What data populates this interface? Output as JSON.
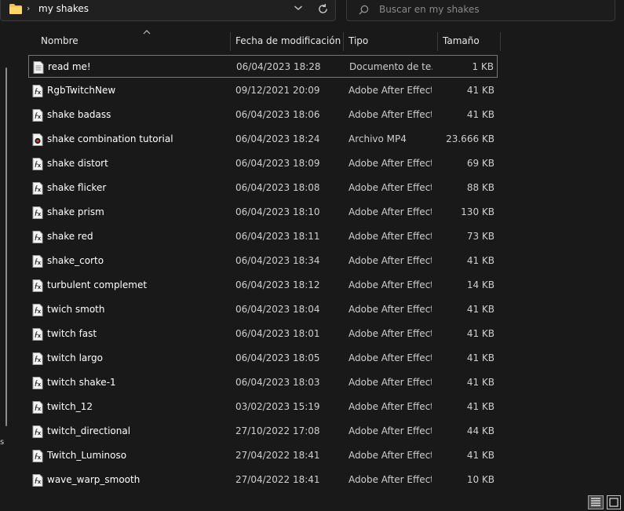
{
  "address": {
    "breadcrumb_sep": "›",
    "folder": "my shakes"
  },
  "search": {
    "placeholder": "Buscar en my shakes"
  },
  "columns": {
    "name": "Nombre",
    "date": "Fecha de modificación",
    "type": "Tipo",
    "size": "Tamaño"
  },
  "left_mark": "s",
  "files": [
    {
      "name": "read me!",
      "date": "06/04/2023 18:28",
      "type": "Documento de te...",
      "size": "1 KB",
      "icon": "text-document-icon"
    },
    {
      "name": "RgbTwitchNew",
      "date": "09/12/2021 20:09",
      "type": "Adobe After Effect...",
      "size": "41 KB",
      "icon": "after-effects-preset-icon"
    },
    {
      "name": "shake badass",
      "date": "06/04/2023 18:06",
      "type": "Adobe After Effect...",
      "size": "41 KB",
      "icon": "after-effects-preset-icon"
    },
    {
      "name": "shake combination tutorial",
      "date": "06/04/2023 18:24",
      "type": "Archivo MP4",
      "size": "23.666 KB",
      "icon": "video-file-icon"
    },
    {
      "name": "shake distort",
      "date": "06/04/2023 18:09",
      "type": "Adobe After Effect...",
      "size": "69 KB",
      "icon": "after-effects-preset-icon"
    },
    {
      "name": "shake flicker",
      "date": "06/04/2023 18:08",
      "type": "Adobe After Effect...",
      "size": "88 KB",
      "icon": "after-effects-preset-icon"
    },
    {
      "name": "shake prism",
      "date": "06/04/2023 18:10",
      "type": "Adobe After Effect...",
      "size": "130 KB",
      "icon": "after-effects-preset-icon"
    },
    {
      "name": "shake red",
      "date": "06/04/2023 18:11",
      "type": "Adobe After Effect...",
      "size": "73 KB",
      "icon": "after-effects-preset-icon"
    },
    {
      "name": "shake_corto",
      "date": "06/04/2023 18:34",
      "type": "Adobe After Effect...",
      "size": "41 KB",
      "icon": "after-effects-preset-icon"
    },
    {
      "name": "turbulent complemet",
      "date": "06/04/2023 18:12",
      "type": "Adobe After Effect...",
      "size": "14 KB",
      "icon": "after-effects-preset-icon"
    },
    {
      "name": "twich smoth",
      "date": "06/04/2023 18:04",
      "type": "Adobe After Effect...",
      "size": "41 KB",
      "icon": "after-effects-preset-icon"
    },
    {
      "name": "twitch fast",
      "date": "06/04/2023 18:01",
      "type": "Adobe After Effect...",
      "size": "41 KB",
      "icon": "after-effects-preset-icon"
    },
    {
      "name": "twitch largo",
      "date": "06/04/2023 18:05",
      "type": "Adobe After Effect...",
      "size": "41 KB",
      "icon": "after-effects-preset-icon"
    },
    {
      "name": "twitch shake-1",
      "date": "06/04/2023 18:03",
      "type": "Adobe After Effect...",
      "size": "41 KB",
      "icon": "after-effects-preset-icon"
    },
    {
      "name": "twitch_12",
      "date": "03/02/2023 15:19",
      "type": "Adobe After Effect...",
      "size": "41 KB",
      "icon": "after-effects-preset-icon"
    },
    {
      "name": "twitch_directional",
      "date": "27/10/2022 17:08",
      "type": "Adobe After Effect...",
      "size": "44 KB",
      "icon": "after-effects-preset-icon"
    },
    {
      "name": "Twitch_Luminoso",
      "date": "27/04/2022 18:41",
      "type": "Adobe After Effect...",
      "size": "41 KB",
      "icon": "after-effects-preset-icon"
    },
    {
      "name": "wave_warp_smooth",
      "date": "27/04/2022 18:41",
      "type": "Adobe After Effect...",
      "size": "10 KB",
      "icon": "after-effects-preset-icon"
    }
  ],
  "colors": {
    "background": "#191919",
    "folder": "#f5c443",
    "selection_border": "#777777"
  }
}
